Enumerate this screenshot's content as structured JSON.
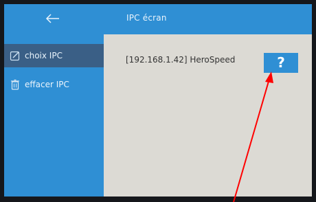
{
  "topbar": {
    "back_icon": "left-arrow-icon",
    "title": "IPC écran"
  },
  "sidebar": {
    "items": [
      {
        "label": "choix IPC",
        "icon": "edit-icon",
        "active": true
      },
      {
        "label": "effacer IPC",
        "icon": "trash-icon",
        "active": false
      }
    ]
  },
  "content": {
    "device_text": "[192.168.1.42] HeroSpeed",
    "help_label": "?"
  },
  "annotation": {
    "arrow_color": "#ff0000"
  },
  "colors": {
    "accent": "#2f8fd4",
    "active_item": "#3a5f86",
    "content_bg": "#dcdad4"
  }
}
